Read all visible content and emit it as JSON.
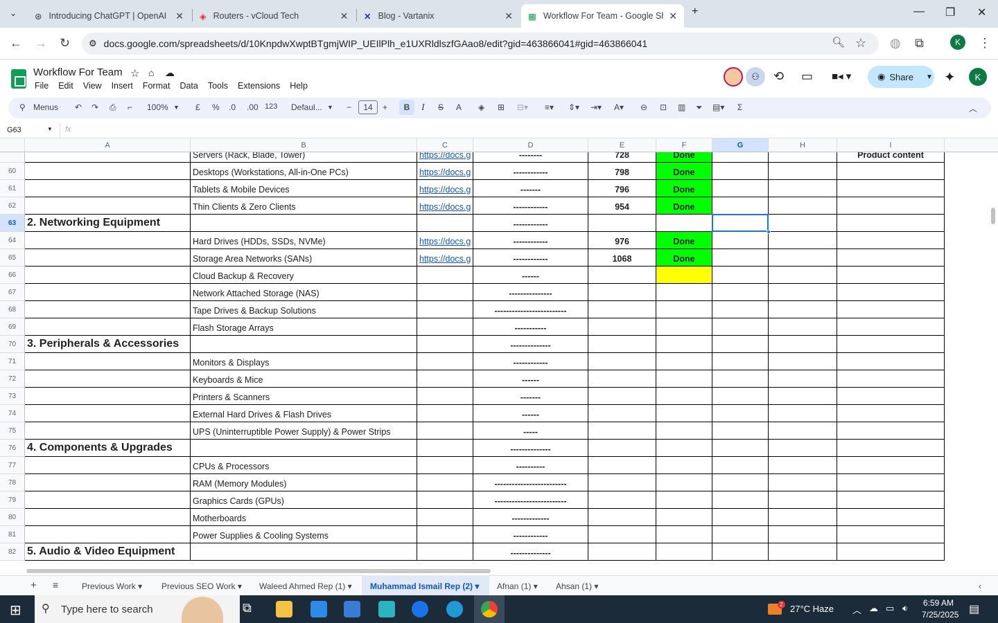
{
  "browser": {
    "tabs": [
      {
        "title": "Introducing ChatGPT | OpenAI"
      },
      {
        "title": "Routers - vCloud Tech"
      },
      {
        "title": "Blog - Vartanix"
      },
      {
        "title": "Workflow For Team - Google Sh"
      }
    ],
    "url": "docs.google.com/spreadsheets/d/10KnpdwXwptBTgmjWIP_UEIlPlh_e1UXRldlszfGAao8/edit?gid=463866041#gid=463866041",
    "profile": "K"
  },
  "doc": {
    "title": "Workflow For Team",
    "menus": [
      "File",
      "Edit",
      "View",
      "Insert",
      "Format",
      "Data",
      "Tools",
      "Extensions",
      "Help"
    ],
    "share": "Share",
    "avatar": "K"
  },
  "toolbar": {
    "search": "Menus",
    "zoom": "100%",
    "currency": "£",
    "percent": "%",
    "dec_dec": ".0",
    "dec_inc": ".00",
    "num": "123",
    "font": "Defaul...",
    "size": "14",
    "bold": "B",
    "italic": "I",
    "strike": "S",
    "text_color": "A"
  },
  "formula": {
    "cellref": "G63",
    "fx": "fx"
  },
  "columns": [
    "A",
    "B",
    "C",
    "D",
    "E",
    "F",
    "G",
    "H",
    "I"
  ],
  "rows": [
    {
      "n": "",
      "b": "Servers (Rack, Blade, Tower)",
      "c": "https://docs.g",
      "d": "--------",
      "e": "728",
      "f": "Done",
      "i": "Product content"
    },
    {
      "n": "60",
      "b": "Desktops (Workstations, All-in-One PCs)",
      "c": "https://docs.g",
      "d": "------------",
      "e": "798",
      "f": "Done"
    },
    {
      "n": "61",
      "b": "Tablets & Mobile Devices",
      "c": "https://docs.g",
      "d": "-------",
      "e": "796",
      "f": "Done"
    },
    {
      "n": "62",
      "b": "Thin Clients & Zero Clients",
      "c": "https://docs.g",
      "d": "------------",
      "e": "954",
      "f": "Done"
    },
    {
      "n": "63",
      "a": "2. Networking Equipment",
      "d": "------------"
    },
    {
      "n": "64",
      "b": "Hard Drives (HDDs, SSDs, NVMe)",
      "c": "https://docs.g",
      "d": "------------",
      "e": "976",
      "f": "Done"
    },
    {
      "n": "65",
      "b": "Storage Area Networks (SANs)",
      "c": "https://docs.g",
      "d": "------------",
      "e": "1068",
      "f": "Done"
    },
    {
      "n": "66",
      "b": "Cloud Backup & Recovery",
      "d": "------",
      "yellow": true
    },
    {
      "n": "67",
      "b": "Network Attached Storage (NAS)",
      "d": "---------------"
    },
    {
      "n": "68",
      "b": "Tape Drives & Backup Solutions",
      "d": "-------------------------"
    },
    {
      "n": "69",
      "b": "Flash Storage Arrays",
      "d": "-----------"
    },
    {
      "n": "70",
      "a": "3. Peripherals & Accessories",
      "d": "--------------"
    },
    {
      "n": "71",
      "b": "Monitors & Displays",
      "d": "------------"
    },
    {
      "n": "72",
      "b": "Keyboards & Mice",
      "d": "------"
    },
    {
      "n": "73",
      "b": "Printers & Scanners",
      "d": "-------"
    },
    {
      "n": "74",
      "b": "External Hard Drives & Flash Drives",
      "d": "------"
    },
    {
      "n": "75",
      "b": "UPS (Uninterruptible Power Supply) & Power Strips",
      "d": "-----"
    },
    {
      "n": "76",
      "a": "4. Components & Upgrades",
      "d": "--------------"
    },
    {
      "n": "77",
      "b": "CPUs & Processors",
      "d": "----------"
    },
    {
      "n": "78",
      "b": "RAM (Memory Modules)",
      "d": "-------------------------"
    },
    {
      "n": "79",
      "b": "Graphics Cards (GPUs)",
      "d": "-------------------------"
    },
    {
      "n": "80",
      "b": "Motherboards",
      "d": "-------------"
    },
    {
      "n": "81",
      "b": "Power Supplies & Cooling Systems",
      "d": "------------"
    },
    {
      "n": "82",
      "a": "5. Audio & Video Equipment",
      "d": "--------------"
    }
  ],
  "sheets": [
    "Previous Work",
    "Previous SEO Work",
    "Waleed Ahmed Rep (1)",
    "Muhammad Ismail Rep (2)",
    "Afnan (1)",
    "Ahsan (1)"
  ],
  "taskbar": {
    "search": "Type here to search",
    "weather": "27°C  Haze",
    "time": "6:59 AM",
    "date": "7/25/2025",
    "badge": "2"
  }
}
